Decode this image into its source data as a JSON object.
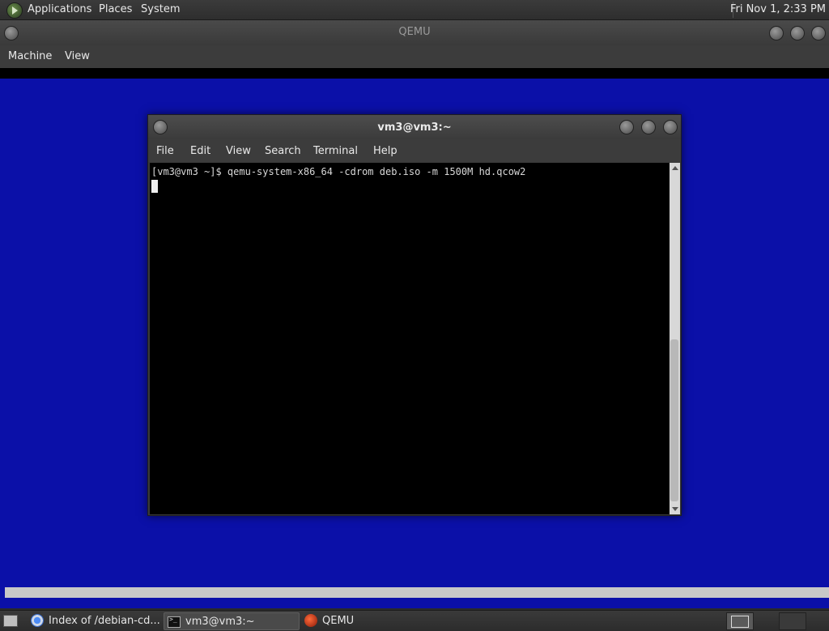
{
  "top_panel": {
    "menus": [
      "Applications",
      "Places",
      "System"
    ],
    "clock": "Fri Nov  1,  2:33 PM"
  },
  "qemu": {
    "title": "QEMU",
    "menus": [
      "Machine",
      "View"
    ]
  },
  "terminal": {
    "title": "vm3@vm3:~",
    "menus": [
      "File",
      "Edit",
      "View",
      "Search",
      "Terminal",
      "Help"
    ],
    "prompt": "[vm3@vm3 ~]$ qemu-system-x86_64 -cdrom deb.iso -m 1500M hd.qcow2"
  },
  "taskbar": {
    "tasks": [
      {
        "label": "Index of /debian-cd...",
        "icon": "chrome-icon"
      },
      {
        "label": "vm3@vm3:~",
        "icon": "terminal-icon"
      },
      {
        "label": "QEMU",
        "icon": "qemu-icon"
      }
    ]
  },
  "colors": {
    "guest_background": "#0b10a8",
    "terminal_background": "#000000"
  }
}
